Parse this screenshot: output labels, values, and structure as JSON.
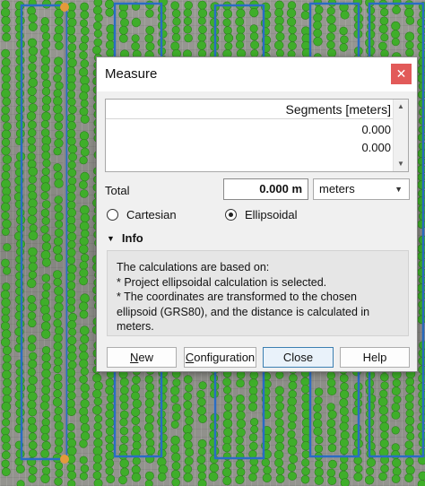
{
  "dialog": {
    "title": "Measure",
    "close_glyph": "✕"
  },
  "segments": {
    "header": "Segments [meters]",
    "rows": [
      "0.000",
      "0.000"
    ]
  },
  "total": {
    "label": "Total",
    "value": "0.000 m",
    "unit_selected": "meters"
  },
  "mode": {
    "cartesian_label": "Cartesian",
    "ellipsoidal_label": "Ellipsoidal",
    "selected": "Ellipsoidal"
  },
  "info": {
    "heading": "Info",
    "lines": [
      "The calculations are based on:",
      "* Project ellipsoidal calculation is selected.",
      "* The coordinates are transformed to the chosen",
      "ellipsoid (GRS80), and the distance is calculated in",
      "meters."
    ]
  },
  "buttons": {
    "new_label": "New",
    "configuration_label": "Configuration",
    "close_label": "Close",
    "help_label": "Help"
  },
  "colors": {
    "plant_green": "#3fae2a",
    "plot_outline_blue": "#2a6cc4",
    "measure_line": "#888888",
    "vertex_orange": "#e39a3b",
    "close_button_red": "#e25a59"
  }
}
